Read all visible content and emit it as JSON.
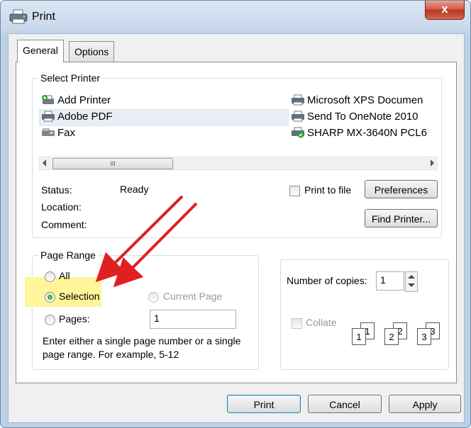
{
  "window": {
    "title": "Print",
    "close_glyph": "x"
  },
  "tabs": [
    {
      "label": "General"
    },
    {
      "label": "Options"
    }
  ],
  "select_printer": {
    "legend": "Select Printer",
    "printers": [
      {
        "name": "Add Printer",
        "icon": "add-printer-icon"
      },
      {
        "name": "Adobe PDF",
        "icon": "printer-icon",
        "selected": true
      },
      {
        "name": "Fax",
        "icon": "fax-icon"
      },
      {
        "name": "Microsoft XPS Documen",
        "icon": "printer-icon"
      },
      {
        "name": "Send To OneNote 2010",
        "icon": "printer-icon"
      },
      {
        "name": "SHARP MX-3640N PCL6",
        "icon": "default-printer-icon"
      }
    ],
    "scroll_thumb_glyph": "III",
    "status_label": "Status:",
    "status_value": "Ready",
    "location_label": "Location:",
    "comment_label": "Comment:",
    "print_to_file_label": "Print to file",
    "preferences_label": "Preferences",
    "find_printer_label": "Find Printer..."
  },
  "page_range": {
    "legend": "Page Range",
    "all_label": "All",
    "selection_label": "Selection",
    "current_page_label": "Current Page",
    "pages_label": "Pages:",
    "pages_value": "1",
    "hint_line1": "Enter either a single page number or a single",
    "hint_line2": "page range.  For example, 5-12",
    "selected_option": "Selection"
  },
  "copies": {
    "label": "Number of copies:",
    "value": "1",
    "collate_label": "Collate",
    "collate_pages": [
      [
        "1",
        "1"
      ],
      [
        "2",
        "2"
      ],
      [
        "3",
        "3"
      ]
    ]
  },
  "buttons": {
    "print": "Print",
    "cancel": "Cancel",
    "apply": "Apply"
  },
  "colors": {
    "highlight": "#fff59a",
    "arrow": "#e02020",
    "close_button": "#c9442f"
  }
}
